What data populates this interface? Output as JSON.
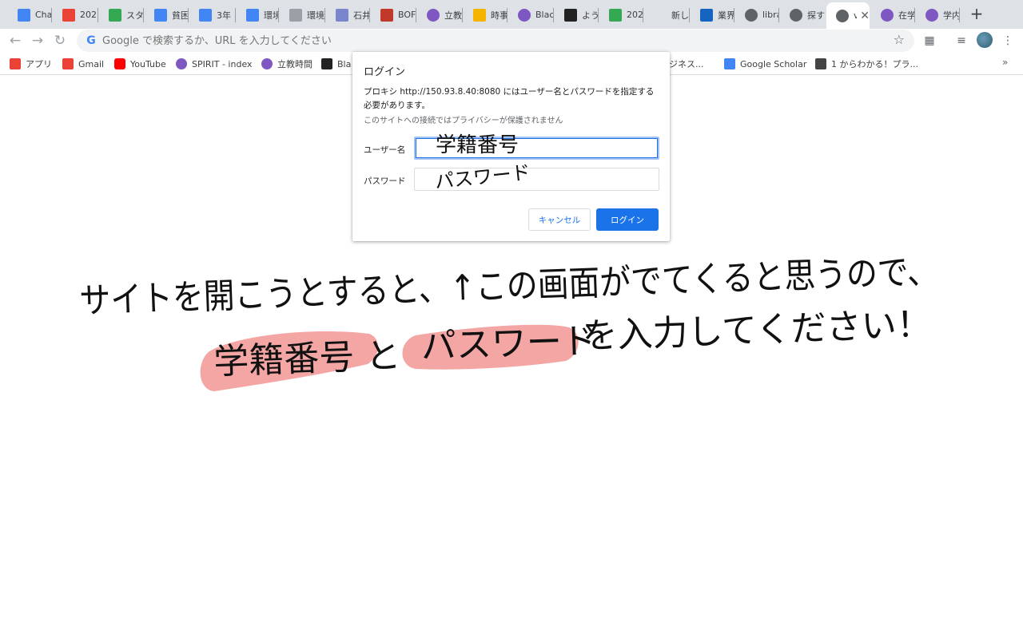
{
  "tabs": [
    {
      "title": "Cha",
      "icon": "docs-icon",
      "color": "#4285f4"
    },
    {
      "title": "202",
      "icon": "gmail-icon",
      "color": "#ea4335"
    },
    {
      "title": "スタ",
      "icon": "drive-icon",
      "color": "#34a853"
    },
    {
      "title": "貧困",
      "icon": "docs-icon",
      "color": "#4285f4"
    },
    {
      "title": "3年",
      "icon": "docs-icon",
      "color": "#4285f4"
    },
    {
      "title": "環境",
      "icon": "docs-icon",
      "color": "#4285f4"
    },
    {
      "title": "環境",
      "icon": "page-icon",
      "color": "#9aa0a6"
    },
    {
      "title": "石井",
      "icon": "play-icon",
      "color": "#7986cb"
    },
    {
      "title": "BOF",
      "icon": "bof-icon",
      "color": "#c0392b"
    },
    {
      "title": "立教",
      "icon": "rikkyo-icon",
      "color": "#7e57c2"
    },
    {
      "title": "時事",
      "icon": "slides-icon",
      "color": "#f4b400"
    },
    {
      "title": "Blac",
      "icon": "rikkyo-icon",
      "color": "#7e57c2"
    },
    {
      "title": "よう",
      "icon": "tbt-icon",
      "color": "#222222"
    },
    {
      "title": "202",
      "icon": "drive-icon",
      "color": "#34a853"
    },
    {
      "title": "新しいタ",
      "icon": "none",
      "color": "#ffffff"
    },
    {
      "title": "業界",
      "icon": "s-icon",
      "color": "#1565c0"
    },
    {
      "title": "libra",
      "icon": "globe-icon",
      "color": "#5f6368"
    },
    {
      "title": "探す",
      "icon": "globe-icon",
      "color": "#5f6368"
    },
    {
      "title": "v",
      "icon": "globe-icon",
      "color": "#5f6368",
      "active": true
    },
    {
      "title": "在学",
      "icon": "rikkyo-icon",
      "color": "#7e57c2"
    },
    {
      "title": "学内",
      "icon": "rikkyo-icon",
      "color": "#7e57c2"
    }
  ],
  "toolbar": {
    "omnibox_placeholder": "Google で検索するか、URL を入力してください",
    "google_g": "G"
  },
  "bookmarks": [
    {
      "label": "アプリ",
      "icon": "apps-grid-icon",
      "color": "#ea4335"
    },
    {
      "label": "Gmail",
      "icon": "gmail-icon",
      "color": "#ea4335"
    },
    {
      "label": "YouTube",
      "icon": "youtube-icon",
      "color": "#ff0000"
    },
    {
      "label": "SPIRIT - index",
      "icon": "rikkyo-icon",
      "color": "#7e57c2"
    },
    {
      "label": "立教時間",
      "icon": "rikkyo-icon",
      "color": "#7e57c2"
    },
    {
      "label": "Bla",
      "icon": "tbt-icon",
      "color": "#222222"
    },
    {
      "label": "ビジネス...",
      "icon": "none",
      "color": "#ffffff"
    },
    {
      "label": "Google Scholar",
      "icon": "scholar-icon",
      "color": "#4285f4"
    },
    {
      "label": "1 からわかる！プラ...",
      "icon": "n-icon",
      "color": "#444444"
    }
  ],
  "dialog": {
    "title": "ログイン",
    "message": "プロキシ http://150.93.8.40:8080 にはユーザー名とパスワードを指定する必要があります。",
    "note": "このサイトへの接続ではプライバシーが保護されません",
    "username_label": "ユーザー名",
    "password_label": "パスワード",
    "username_value": "",
    "password_value": "",
    "cancel_label": "キャンセル",
    "login_label": "ログイン"
  },
  "annotations": {
    "username_hint": "学籍番号",
    "password_hint": "パスワード",
    "line1": "サイトを開こうとすると、↑この画面がでてくると思うので、",
    "line2_prefix": "",
    "highlight1": "学籍番号",
    "connector": "と",
    "highlight2": "パスワード",
    "line2_suffix": "を入力してください！",
    "highlight_color": "#f4a6a4"
  }
}
